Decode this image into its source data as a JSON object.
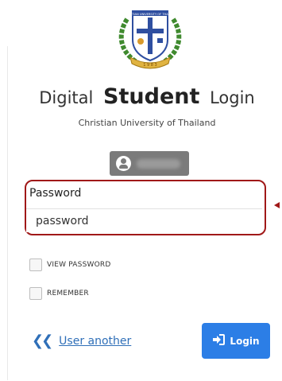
{
  "logo": {
    "name": "university-seal",
    "ring_text": "CHRISTIAN UNIVERSITY OF THAILAND",
    "year": "1 9 8 3"
  },
  "header": {
    "title_prefix": "Digital",
    "title_emphasis": "Student",
    "title_suffix": "Login",
    "subtitle": "Christian University of Thailand"
  },
  "user_chip": {
    "icon": "user-circle-icon"
  },
  "password": {
    "label": "Password",
    "placeholder": "password"
  },
  "options": {
    "view_password": "VIEW PASSWORD",
    "remember": "REMEMBER"
  },
  "links": {
    "user_another": "User another",
    "user_another_icon": "double-chevron-left-icon"
  },
  "login": {
    "label": "Login",
    "icon": "sign-in-icon"
  },
  "colors": {
    "primary_button": "#2c7ee6",
    "link": "#2f6fb8",
    "highlight": "#a01818",
    "user_chip": "#7b7b7b"
  }
}
